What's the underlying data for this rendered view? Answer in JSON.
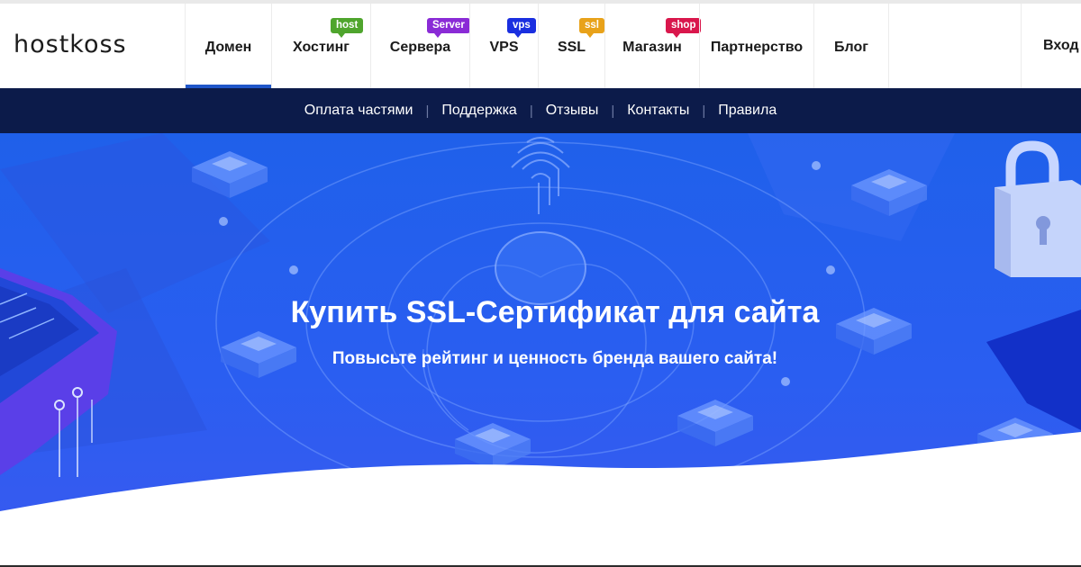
{
  "brand": {
    "logo_text": "hostkoss"
  },
  "nav": {
    "items": [
      {
        "label": "Домен",
        "active": true,
        "badge": null
      },
      {
        "label": "Хостинг",
        "active": false,
        "badge": {
          "text": "host",
          "color": "#4fa52d"
        }
      },
      {
        "label": "Сервера",
        "active": false,
        "badge": {
          "text": "Server",
          "color": "#8a2bd6"
        }
      },
      {
        "label": "VPS",
        "active": false,
        "badge": {
          "text": "vps",
          "color": "#1a2fe0"
        }
      },
      {
        "label": "SSL",
        "active": false,
        "badge": {
          "text": "ssl",
          "color": "#e8a21a"
        }
      },
      {
        "label": "Магазин",
        "active": false,
        "badge": {
          "text": "shop",
          "color": "#d9174c"
        }
      },
      {
        "label": "Партнерство",
        "active": false,
        "badge": null
      },
      {
        "label": "Блог",
        "active": false,
        "badge": null
      }
    ],
    "login_label": "Вход"
  },
  "subnav": {
    "items": [
      "Оплата частями",
      "Поддержка",
      "Отзывы",
      "Контакты",
      "Правила"
    ]
  },
  "hero": {
    "title": "Купить SSL-Сертификат для сайта",
    "subtitle": "Повысьте рейтинг и ценность бренда вашего сайта!"
  },
  "colors": {
    "accent": "#1f56c9",
    "subnav_bg": "#0c1b4a",
    "hero_bg": "#2a5ef1"
  },
  "icons": [
    "fingerprint-icon",
    "padlock-icon",
    "server-chip-icon"
  ]
}
